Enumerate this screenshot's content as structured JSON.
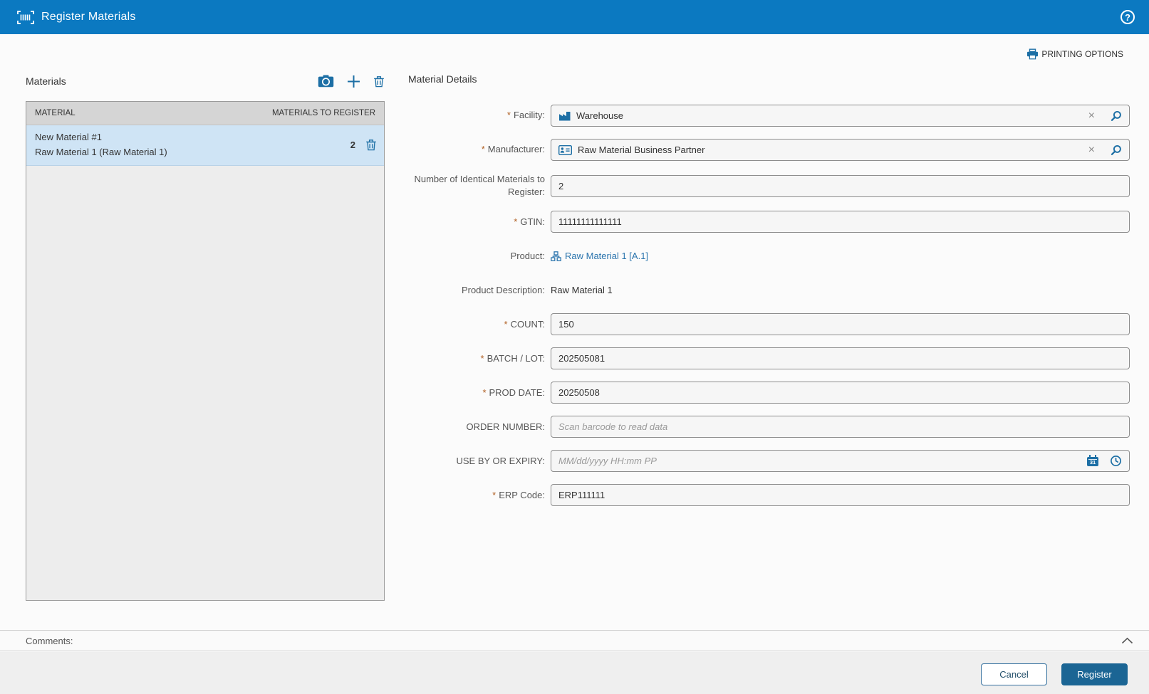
{
  "header": {
    "title": "Register Materials"
  },
  "toolbar": {
    "printing_options_label": "PRINTING OPTIONS"
  },
  "materials_panel": {
    "title": "Materials",
    "columns": {
      "material": "MATERIAL",
      "to_register": "MATERIALS TO REGISTER"
    },
    "row": {
      "line1": "New Material #1",
      "line2": "Raw Material 1 (Raw Material 1)",
      "count": "2"
    }
  },
  "details": {
    "title": "Material Details",
    "required_marker": "*",
    "fields": {
      "facility": {
        "label": "Facility:",
        "value": "Warehouse"
      },
      "manufacturer": {
        "label": "Manufacturer:",
        "value": "Raw Material Business Partner"
      },
      "num_identical": {
        "label": "Number of Identical Materials to Register:",
        "value": "2"
      },
      "gtin": {
        "label": "GTIN:",
        "value": "11111111111111"
      },
      "product": {
        "label": "Product:",
        "link_text": "Raw Material 1 [A.1]"
      },
      "product_description": {
        "label": "Product Description:",
        "value": "Raw Material 1"
      },
      "count": {
        "label": "COUNT:",
        "value": "150"
      },
      "batch_lot": {
        "label": "BATCH / LOT:",
        "value": "202505081"
      },
      "prod_date": {
        "label": "PROD DATE:",
        "value": "20250508"
      },
      "order_number": {
        "label": "ORDER NUMBER:",
        "placeholder": "Scan barcode to read data"
      },
      "use_by": {
        "label": "USE BY OR EXPIRY:",
        "placeholder": "MM/dd/yyyy HH:mm PP"
      },
      "erp_code": {
        "label": "ERP Code:",
        "value": "ERP111111"
      }
    }
  },
  "comments": {
    "label": "Comments:"
  },
  "footer": {
    "cancel_label": "Cancel",
    "register_label": "Register"
  },
  "icons": {
    "help_glyph": "?",
    "clear_glyph": "×",
    "calendar_day": "31"
  },
  "colors": {
    "header_blue": "#0b79c1",
    "icon_blue": "#1d6fa5",
    "link_blue": "#2a74ad",
    "register_button_blue": "#1b6594",
    "required_marker_orange": "#b05f22",
    "selected_row_blue": "#cfe4f5"
  }
}
